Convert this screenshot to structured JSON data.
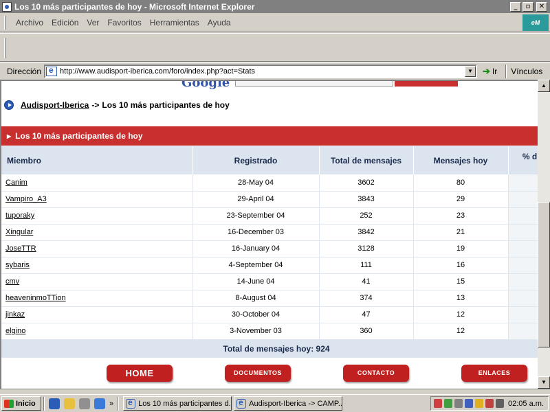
{
  "window": {
    "title": "Los 10 más participantes de hoy - Microsoft Internet Explorer",
    "minimize": "_",
    "maximize": "▫",
    "close": "✕"
  },
  "menu": {
    "items": [
      "Archivo",
      "Edición",
      "Ver",
      "Favoritos",
      "Herramientas",
      "Ayuda"
    ],
    "brand": "eM"
  },
  "address": {
    "label": "Dirección",
    "url": "http://www.audisport-iberica.com/foro/index.php?act=Stats",
    "go_label": "Ir",
    "links_label": "Vínculos"
  },
  "breadcrumb": {
    "home": "Audisport-Iberica",
    "separator": "->",
    "current": "Los 10 más participantes de hoy"
  },
  "section": {
    "title": "Los 10 más participantes de hoy"
  },
  "table": {
    "headers": [
      "Miembro",
      "Registrado",
      "Total de mensajes",
      "Mensajes hoy",
      "% d"
    ],
    "rows": [
      {
        "member": "Canim",
        "registered": "28-May 04",
        "total": "3602",
        "today": "80"
      },
      {
        "member": "Vampiro_A3",
        "registered": "29-April 04",
        "total": "3843",
        "today": "29"
      },
      {
        "member": "tuporaky",
        "registered": "23-September 04",
        "total": "252",
        "today": "23"
      },
      {
        "member": "Xingular",
        "registered": "16-December 03",
        "total": "3842",
        "today": "21"
      },
      {
        "member": "JoseTTR",
        "registered": "16-January 04",
        "total": "3128",
        "today": "19"
      },
      {
        "member": "sybaris",
        "registered": "4-September 04",
        "total": "111",
        "today": "16"
      },
      {
        "member": "cmv",
        "registered": "14-June 04",
        "total": "41",
        "today": "15"
      },
      {
        "member": "heaveninmoTTion",
        "registered": "8-August 04",
        "total": "374",
        "today": "13"
      },
      {
        "member": "jinkaz",
        "registered": "30-October 04",
        "total": "47",
        "today": "12"
      },
      {
        "member": "elgino",
        "registered": "3-November 03",
        "total": "360",
        "today": "12"
      }
    ],
    "total_label": "Total de mensajes hoy: 924"
  },
  "nav": {
    "home": "HOME",
    "documents": "DOCUMENTOS",
    "contact": "CONTACTO",
    "links": "ENLACES"
  },
  "taskbar": {
    "start": "Inicio",
    "more": "»",
    "tasks": [
      "Los 10 más participantes d...",
      "Audisport-Iberica -> CAMP..."
    ],
    "clock": "02:05 a.m."
  }
}
